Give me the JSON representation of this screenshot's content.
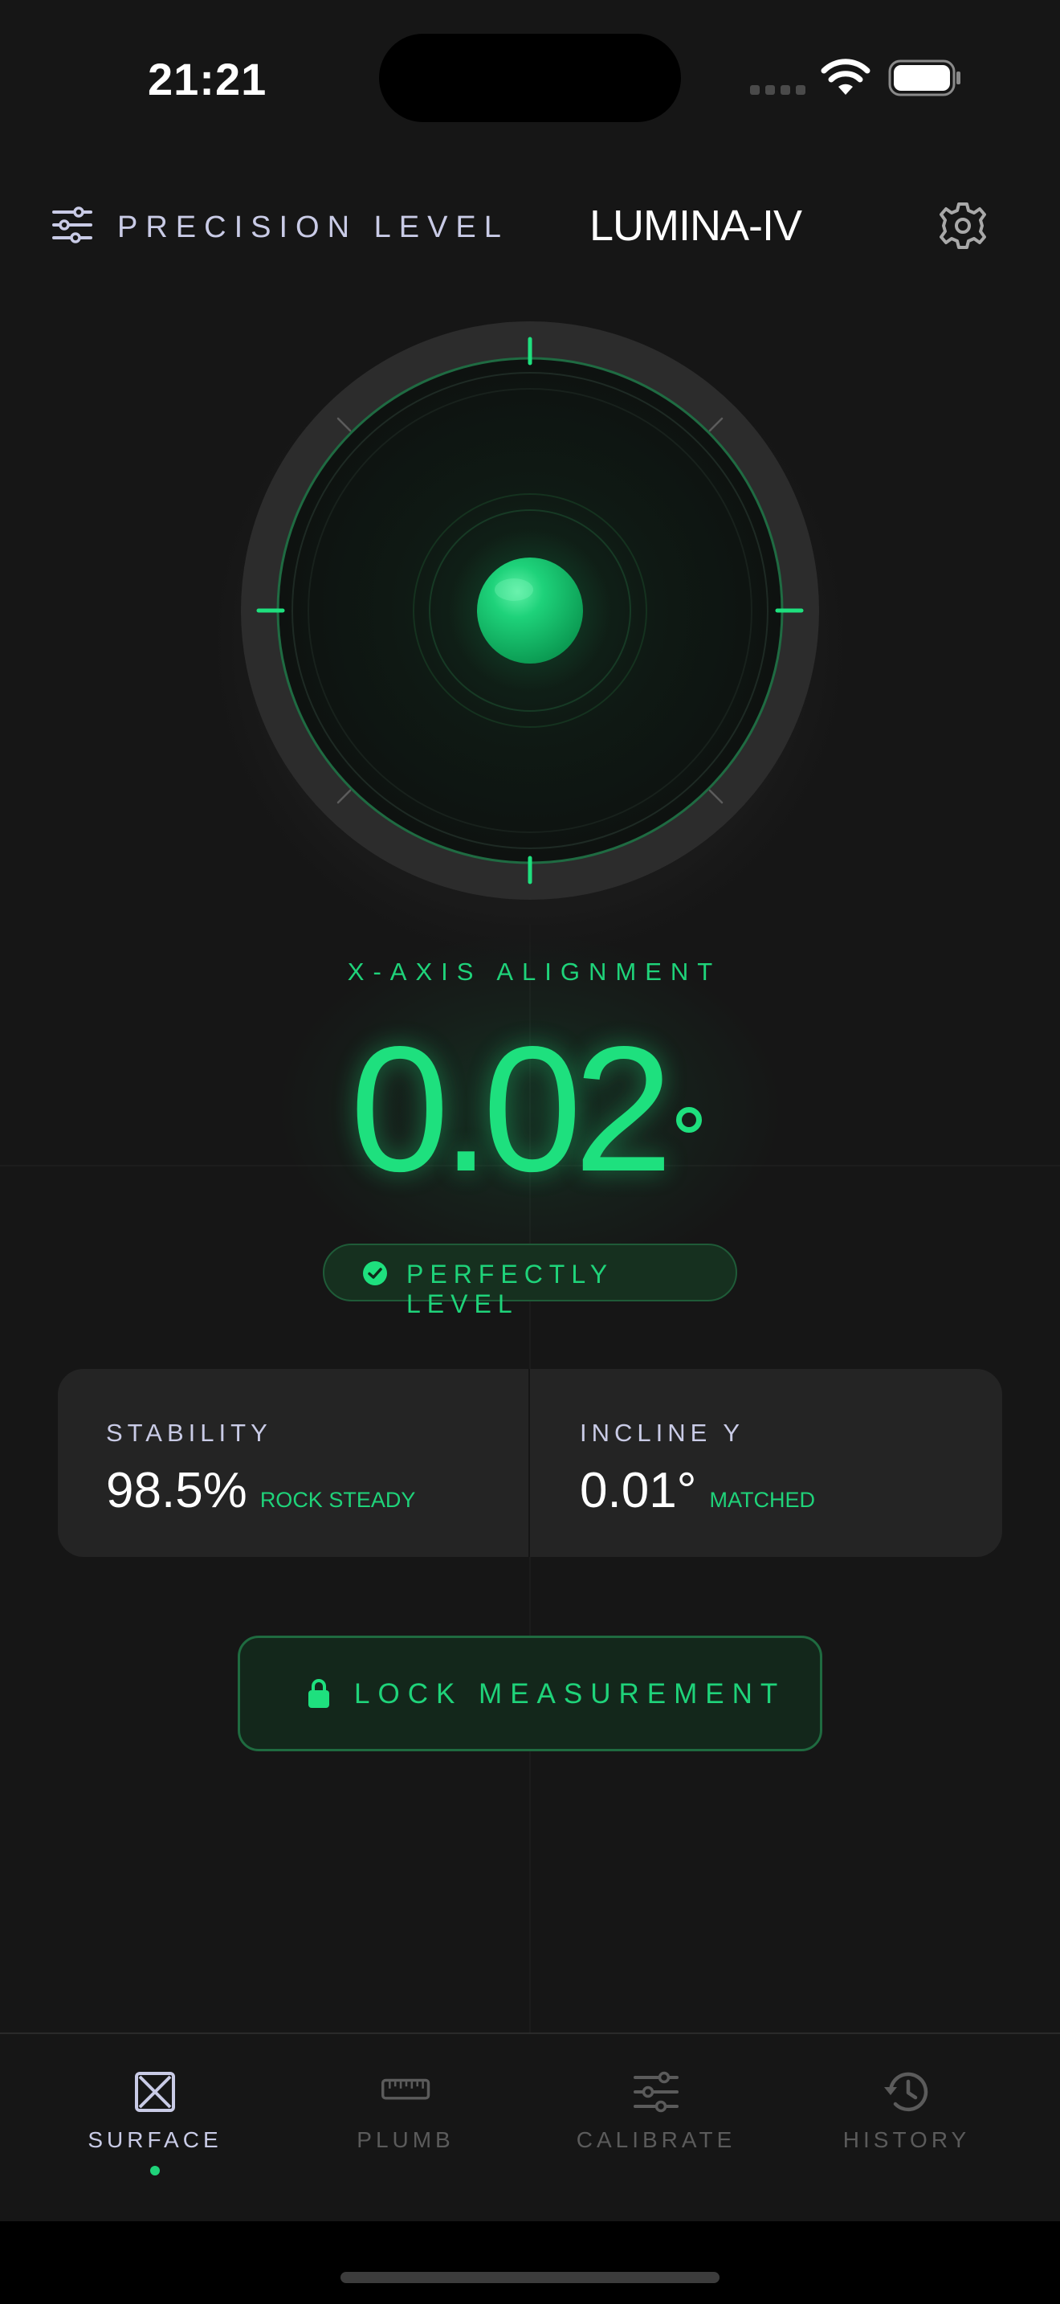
{
  "status_bar": {
    "time": "21:21"
  },
  "header": {
    "title": "PRECISION LEVEL",
    "device": "LUMINA-IV",
    "menu_icon": "sliders-icon",
    "settings_icon": "gear-icon"
  },
  "readout": {
    "label": "X-AXIS ALIGNMENT",
    "value": "0.02",
    "unit": "°",
    "status": "PERFECTLY LEVEL"
  },
  "stats": [
    {
      "label": "STABILITY",
      "value": "98.5%",
      "note": "ROCK STEADY"
    },
    {
      "label": "INCLINE Y",
      "value": "0.01°",
      "note": "MATCHED"
    }
  ],
  "actions": {
    "lock_label": "LOCK MEASUREMENT"
  },
  "tabs": [
    {
      "label": "SURFACE",
      "icon": "surface-icon",
      "active": true
    },
    {
      "label": "PLUMB",
      "icon": "ruler-icon",
      "active": false
    },
    {
      "label": "CALIBRATE",
      "icon": "sliders-icon",
      "active": false
    },
    {
      "label": "HISTORY",
      "icon": "history-icon",
      "active": false
    }
  ],
  "colors": {
    "accent": "#1ee07e",
    "background": "#161616",
    "card": "#242424",
    "muted_text": "#c9cbe6",
    "inactive_tab": "#5b5b5b"
  }
}
